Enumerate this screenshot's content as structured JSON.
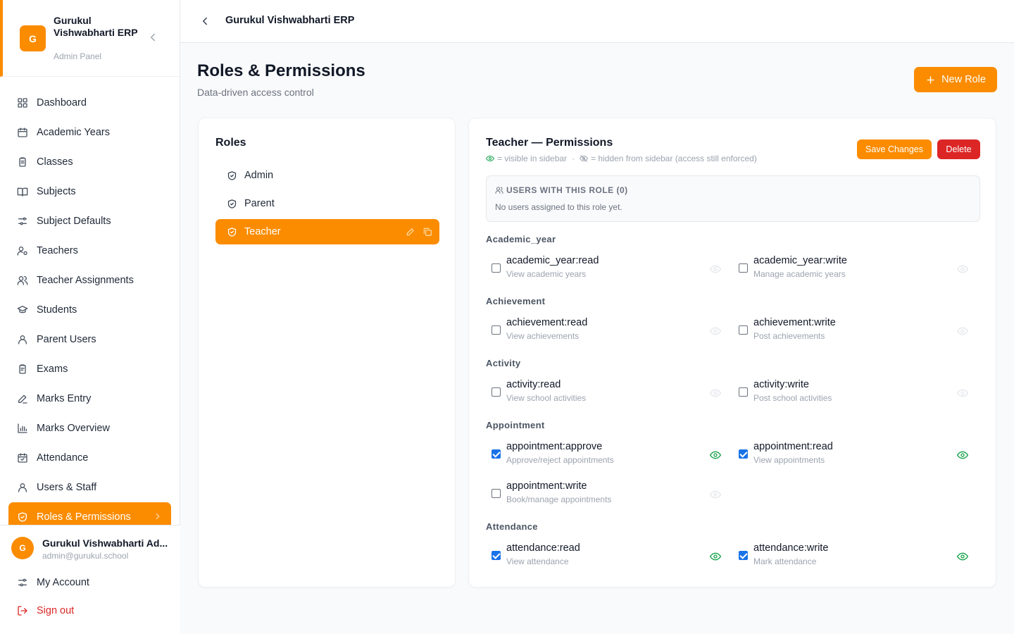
{
  "brand": {
    "logo_letter": "G",
    "name": "Gurukul Vishwabharti ERP",
    "subtitle": "Admin Panel"
  },
  "colors": {
    "accent": "#fb8c00",
    "danger": "#dc2626",
    "visible_eye": "#16a34a",
    "checkbox": "#1a73e8"
  },
  "nav": [
    {
      "label": "Dashboard",
      "icon": "dashboard-icon"
    },
    {
      "label": "Academic Years",
      "icon": "calendar-icon"
    },
    {
      "label": "Classes",
      "icon": "clipboard-icon"
    },
    {
      "label": "Subjects",
      "icon": "book-icon"
    },
    {
      "label": "Subject Defaults",
      "icon": "sliders-icon"
    },
    {
      "label": "Teachers",
      "icon": "user-cog-icon"
    },
    {
      "label": "Teacher Assignments",
      "icon": "users-icon"
    },
    {
      "label": "Students",
      "icon": "graduation-cap-icon"
    },
    {
      "label": "Parent Users",
      "icon": "user-icon"
    },
    {
      "label": "Exams",
      "icon": "clipboard-list-icon"
    },
    {
      "label": "Marks Entry",
      "icon": "pen-icon"
    },
    {
      "label": "Marks Overview",
      "icon": "bar-chart-icon"
    },
    {
      "label": "Attendance",
      "icon": "calendar-check-icon"
    },
    {
      "label": "Users & Staff",
      "icon": "user-icon"
    },
    {
      "label": "Roles & Permissions",
      "icon": "shield-icon",
      "active": true
    }
  ],
  "user": {
    "avatar_letter": "G",
    "name": "Gurukul Vishwabharti Ad...",
    "email": "admin@gurukul.school",
    "my_account": "My Account",
    "sign_out": "Sign out"
  },
  "topbar": {
    "title": "Gurukul Vishwabharti ERP"
  },
  "page": {
    "title": "Roles & Permissions",
    "subtitle": "Data-driven access control",
    "new_role_label": "New Role"
  },
  "roles_panel": {
    "title": "Roles",
    "roles": [
      {
        "name": "Admin",
        "active": false
      },
      {
        "name": "Parent",
        "active": false
      },
      {
        "name": "Teacher",
        "active": true
      }
    ]
  },
  "permissions_panel": {
    "title": "Teacher — Permissions",
    "legend_visible": "= visible in sidebar",
    "legend_hidden": "= hidden from sidebar (access still enforced)",
    "legend_separator": "·",
    "save_label": "Save Changes",
    "delete_label": "Delete",
    "users_heading": "USERS WITH THIS ROLE (0)",
    "users_empty": "No users assigned to this role yet.",
    "groups": [
      {
        "name": "Academic_year",
        "perms": [
          {
            "name": "academic_year:read",
            "desc": "View academic years",
            "checked": false,
            "visible": false
          },
          {
            "name": "academic_year:write",
            "desc": "Manage academic years",
            "checked": false,
            "visible": false
          }
        ]
      },
      {
        "name": "Achievement",
        "perms": [
          {
            "name": "achievement:read",
            "desc": "View achievements",
            "checked": false,
            "visible": false
          },
          {
            "name": "achievement:write",
            "desc": "Post achievements",
            "checked": false,
            "visible": false
          }
        ]
      },
      {
        "name": "Activity",
        "perms": [
          {
            "name": "activity:read",
            "desc": "View school activities",
            "checked": false,
            "visible": false
          },
          {
            "name": "activity:write",
            "desc": "Post school activities",
            "checked": false,
            "visible": false
          }
        ]
      },
      {
        "name": "Appointment",
        "perms": [
          {
            "name": "appointment:approve",
            "desc": "Approve/reject appointments",
            "checked": true,
            "visible": true
          },
          {
            "name": "appointment:read",
            "desc": "View appointments",
            "checked": true,
            "visible": true
          },
          {
            "name": "appointment:write",
            "desc": "Book/manage appointments",
            "checked": false,
            "visible": false
          }
        ]
      },
      {
        "name": "Attendance",
        "perms": [
          {
            "name": "attendance:read",
            "desc": "View attendance",
            "checked": true,
            "visible": true
          },
          {
            "name": "attendance:write",
            "desc": "Mark attendance",
            "checked": true,
            "visible": true
          }
        ]
      }
    ]
  }
}
